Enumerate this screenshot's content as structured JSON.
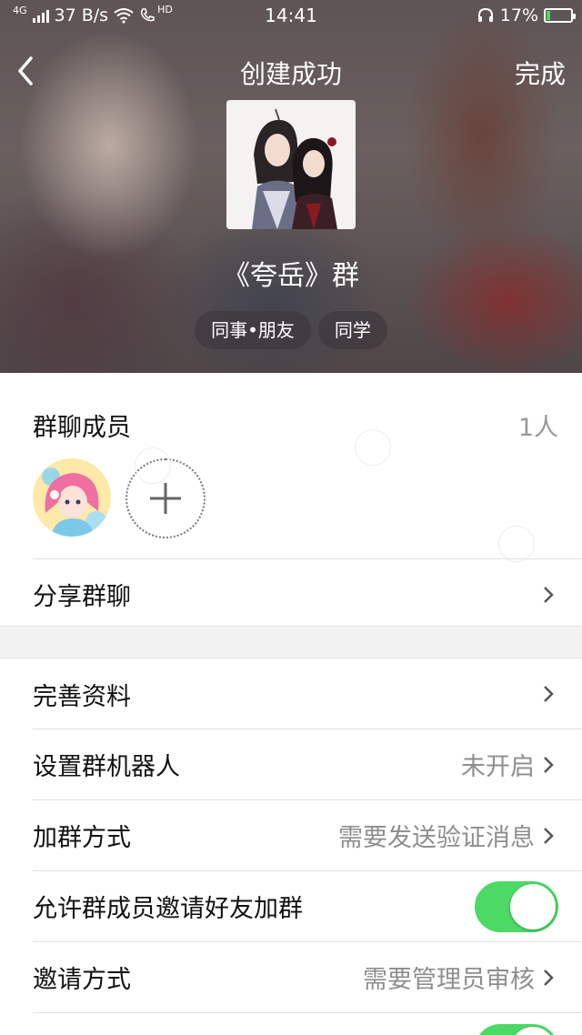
{
  "status_bar": {
    "network": "4G",
    "speed": "37 B/s",
    "hd": "HD",
    "time": "14:41",
    "battery": "17%",
    "battery_level": 0.17
  },
  "nav": {
    "title": "创建成功",
    "done_label": "完成"
  },
  "group": {
    "name": "《夸岳》群",
    "tags": [
      "同事•朋友",
      "同学"
    ]
  },
  "members": {
    "label": "群聊成员",
    "count": "1人"
  },
  "rows": {
    "share": "分享群聊",
    "profile": "完善资料",
    "robot": {
      "label": "设置群机器人",
      "value": "未开启"
    },
    "join_method": {
      "label": "加群方式",
      "value": "需要发送验证消息"
    },
    "allow_invite": {
      "label": "允许群成员邀请好友加群",
      "enabled": true
    },
    "invite_method": {
      "label": "邀请方式",
      "value": "需要管理员审核"
    }
  },
  "colors": {
    "toggle_on": "#4cd964",
    "secondary_text": "#8e8e8e"
  }
}
